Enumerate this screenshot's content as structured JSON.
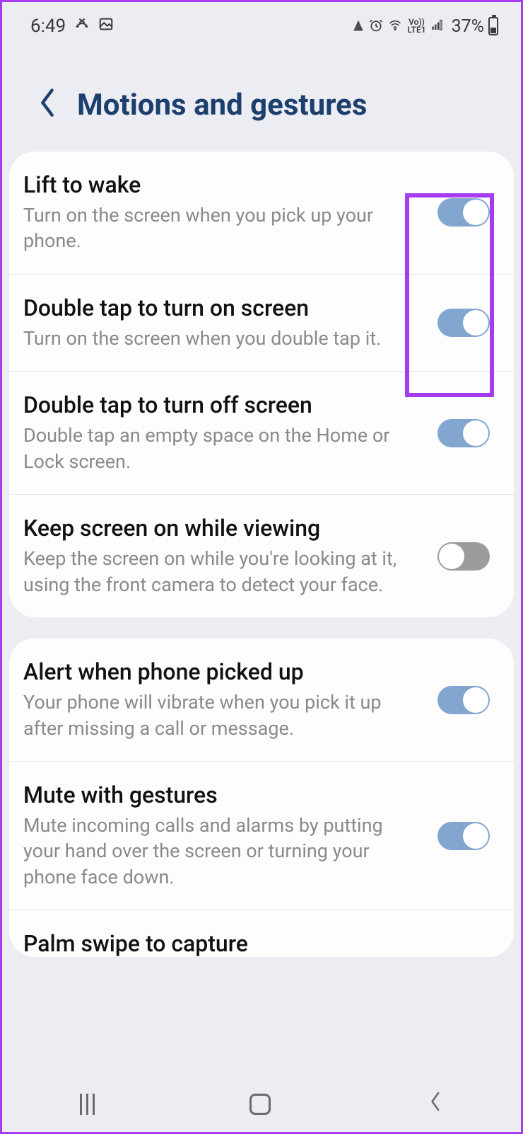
{
  "status": {
    "time": "6:49",
    "battery": "37%"
  },
  "header": {
    "title": "Motions and gestures"
  },
  "groups": [
    {
      "items": [
        {
          "title": "Lift to wake",
          "desc": "Turn on the screen when you pick up your phone.",
          "on": true
        },
        {
          "title": "Double tap to turn on screen",
          "desc": "Turn on the screen when you double tap it.",
          "on": true
        },
        {
          "title": "Double tap to turn off screen",
          "desc": "Double tap an empty space on the Home or Lock screen.",
          "on": true
        },
        {
          "title": "Keep screen on while viewing",
          "desc": "Keep the screen on while you're looking at it, using the front camera to detect your face.",
          "on": false
        }
      ]
    },
    {
      "items": [
        {
          "title": "Alert when phone picked up",
          "desc": "Your phone will vibrate when you pick it up after missing a call or message.",
          "on": true
        },
        {
          "title": "Mute with gestures",
          "desc": "Mute incoming calls and alarms by putting your hand over the screen or turning your phone face down.",
          "on": true
        }
      ],
      "partial": {
        "title": "Palm swipe to capture"
      }
    }
  ]
}
